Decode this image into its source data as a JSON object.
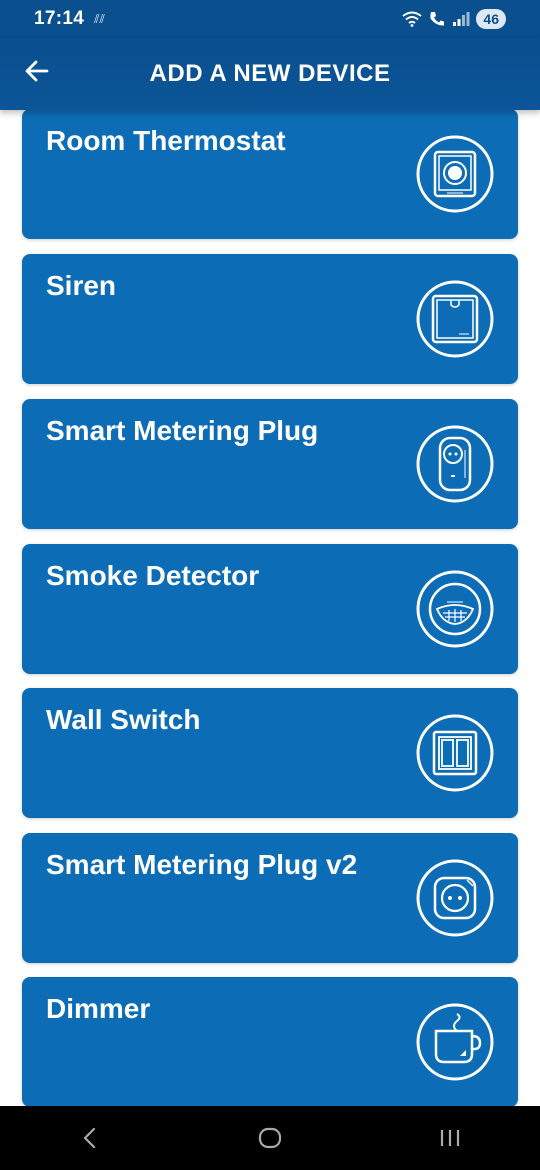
{
  "status": {
    "time": "17:14",
    "misc": "⫽⫽",
    "battery": "46"
  },
  "header": {
    "title": "ADD A NEW DEVICE",
    "back_icon": "arrow-left-icon"
  },
  "devices": [
    {
      "label": "Room Thermostat",
      "icon": "thermostat-icon"
    },
    {
      "label": "Siren",
      "icon": "siren-icon"
    },
    {
      "label": "Smart Metering Plug",
      "icon": "metering-plug-icon"
    },
    {
      "label": "Smoke Detector",
      "icon": "smoke-detector-icon"
    },
    {
      "label": "Wall Switch",
      "icon": "wall-switch-icon"
    },
    {
      "label": "Smart Metering Plug v2",
      "icon": "metering-plug-v2-icon"
    },
    {
      "label": "Dimmer",
      "icon": "dimmer-icon"
    }
  ],
  "navigation": {
    "back": "nav-back-icon",
    "home": "nav-home-icon",
    "recents": "nav-recents-icon"
  },
  "colors": {
    "header": "#0a4f8e",
    "card": "#0c6db6",
    "nav": "#000000"
  }
}
